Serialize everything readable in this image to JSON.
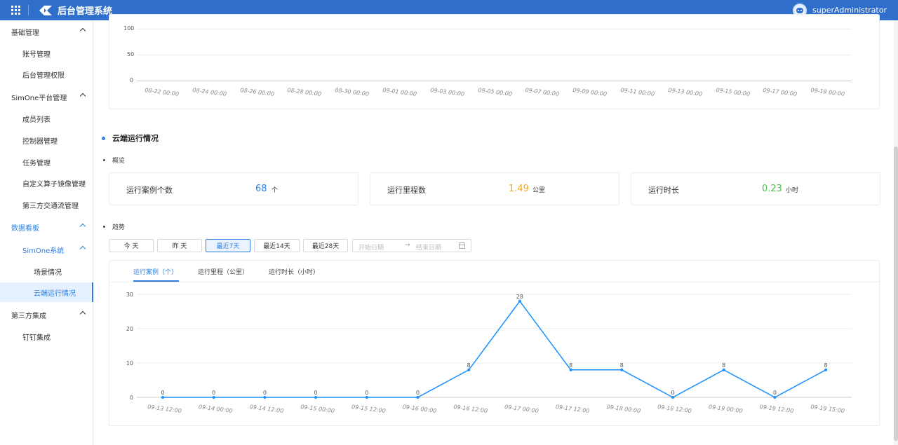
{
  "header": {
    "app_title": "后台管理系统",
    "username": "superAdministrator"
  },
  "sidebar": {
    "items": [
      {
        "label": "基础管理"
      },
      {
        "label": "账号管理"
      },
      {
        "label": "后台管理权限"
      },
      {
        "label": "SimOne平台管理"
      },
      {
        "label": "成员列表"
      },
      {
        "label": "控制器管理"
      },
      {
        "label": "任务管理"
      },
      {
        "label": "自定义算子镜像管理"
      },
      {
        "label": "第三方交通流管理"
      },
      {
        "label": "数据看板"
      },
      {
        "label": "SimOne系统"
      },
      {
        "label": "场景情况"
      },
      {
        "label": "云端运行情况"
      },
      {
        "label": "第三方集成"
      },
      {
        "label": "钉钉集成"
      }
    ]
  },
  "top_chart": {
    "y_ticks": [
      "100",
      "50",
      "0"
    ],
    "x_ticks": [
      "08-22 00:00",
      "08-24 00:00",
      "08-26 00:00",
      "08-28 00:00",
      "08-30 00:00",
      "09-01 00:00",
      "09-03 00:00",
      "09-05 00:00",
      "09-07 00:00",
      "09-09 00:00",
      "09-11 00:00",
      "09-13 00:00",
      "09-15 00:00",
      "09-17 00:00",
      "09-19 00:00"
    ]
  },
  "section": {
    "title": "云端运行情况",
    "overview_label": "概览",
    "trend_label": "趋势"
  },
  "stats": [
    {
      "label": "运行案例个数",
      "value": "68",
      "unit": "个",
      "color": "#2f7fe0"
    },
    {
      "label": "运行里程数",
      "value": "1.49",
      "unit": "公里",
      "color": "#f5a623"
    },
    {
      "label": "运行时长",
      "value": "0.23",
      "unit": "小时",
      "color": "#52b84f"
    }
  ],
  "filters": {
    "buttons": [
      "今 天",
      "昨 天",
      "最近7天",
      "最近14天",
      "最近28天"
    ],
    "active": "最近7天",
    "start_placeholder": "开始日期",
    "end_placeholder": "结束日期",
    "arrow": "→"
  },
  "tabs": [
    "运行案例（个）",
    "运行里程（公里）",
    "运行时长（小时）"
  ],
  "chart_data": {
    "type": "line",
    "categories": [
      "09-13 12:00",
      "09-14 00:00",
      "09-14 12:00",
      "09-15 00:00",
      "09-15 12:00",
      "09-16 00:00",
      "09-16 12:00",
      "09-17 00:00",
      "09-17 12:00",
      "09-18 00:00",
      "09-18 12:00",
      "09-19 00:00",
      "09-19 12:00",
      "09-19 15:00"
    ],
    "values": [
      0,
      0,
      0,
      0,
      0,
      0,
      8,
      28,
      8,
      8,
      0,
      8,
      0,
      8
    ],
    "y_ticks": [
      0,
      10,
      20,
      30
    ],
    "ylim": [
      0,
      30
    ],
    "line_color": "#1890ff",
    "grid": true
  }
}
